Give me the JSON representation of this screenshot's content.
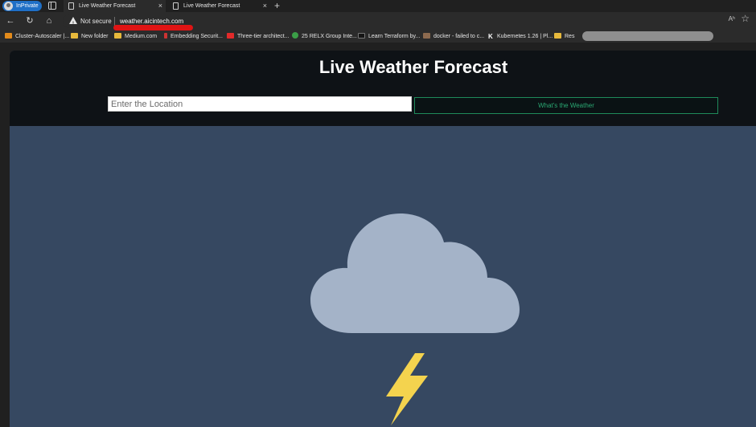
{
  "browser": {
    "inprivate_label": "InPrivate",
    "tabs": [
      {
        "title": "Live Weather Forecast",
        "close": "×"
      },
      {
        "title": "Live Weather Forecast",
        "close": "×"
      }
    ],
    "new_tab": "+",
    "nav": {
      "back": "←",
      "reload": "↻",
      "home": "⌂"
    },
    "security_label": "Not secure",
    "url": "weather.aicintech.com",
    "read_aloud": "Aʰ",
    "favorite": "☆",
    "bookmarks": [
      {
        "label": "Cluster-Autoscaler |...",
        "icon": "orange"
      },
      {
        "label": "New folder",
        "icon": "folder"
      },
      {
        "label": "Medium.com",
        "icon": "folder"
      },
      {
        "label": "Embedding Securit...",
        "icon": "emb"
      },
      {
        "label": "Three-tier architect...",
        "icon": "yt"
      },
      {
        "label": "25 RELX Group Inte...",
        "icon": "relx"
      },
      {
        "label": "Learn Terraform by...",
        "icon": "dark"
      },
      {
        "label": "docker - failed to c...",
        "icon": "docker"
      },
      {
        "label": "Kubernetes 1.26 | Pl...",
        "icon": "k"
      },
      {
        "label": "Res",
        "icon": "folder"
      }
    ]
  },
  "app": {
    "title": "Live Weather Forecast",
    "location_placeholder": "Enter the Location",
    "location_value": "",
    "submit_label": "What's the Weather",
    "weather_icon": "cloud-lightning-icon",
    "colors": {
      "page_bg": "#364861",
      "header_bg": "#0e1216",
      "button_accent": "#2aa872",
      "cloud": "#a4b3c8",
      "bolt": "#f4d34e"
    }
  }
}
